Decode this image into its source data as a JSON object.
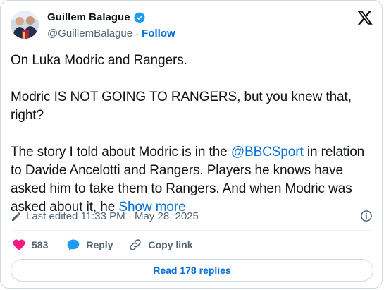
{
  "author": {
    "display_name": "Guillem Balague",
    "handle": "@GuillemBalague",
    "separator": "·",
    "follow_label": "Follow",
    "verified_color": "#1d9bf0"
  },
  "tweet": {
    "line1": "On Luka Modric and Rangers.",
    "line2": "Modric IS NOT GOING TO RANGERS, but you knew that, right?",
    "line3_before": "The story I told about Modric is in the ",
    "mention": "@BBCSport",
    "line3_after": " in relation to Davide Ancelotti and Rangers. Players he knows have asked him to take them to Rangers. And when Modric was asked about it, he ",
    "show_more_label": "Show more"
  },
  "meta": {
    "edited_text": "Last edited 11:33 PM · May 28, 2025"
  },
  "actions": {
    "likes_count": "583",
    "reply_label": "Reply",
    "copy_link_label": "Copy link"
  },
  "replies_button": {
    "label": "Read 178 replies"
  },
  "colors": {
    "accent": "#006fd6",
    "like": "#f91880",
    "muted": "#536471",
    "text": "#0f1419"
  }
}
